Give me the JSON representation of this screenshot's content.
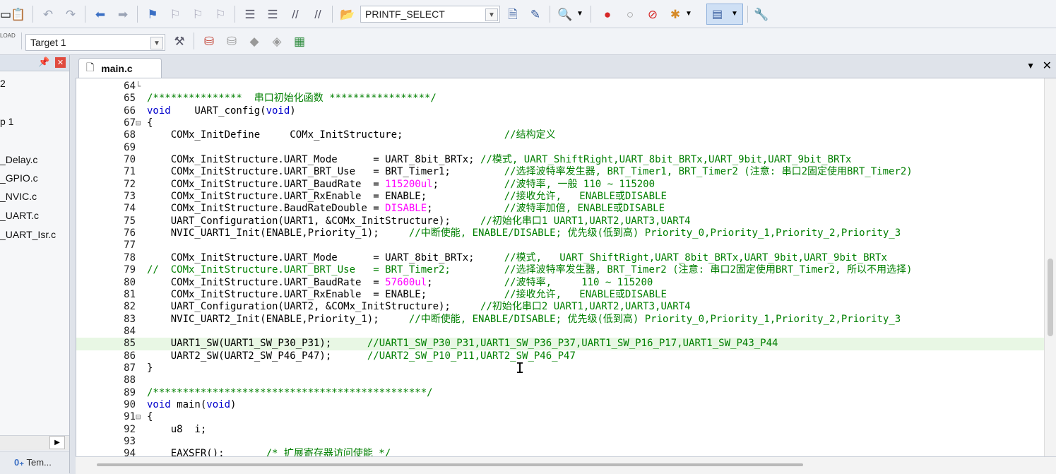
{
  "toolbar": {
    "target_combo_value": "PRINTF_SELECT",
    "target_label": "Target 1",
    "load_label": "LOAD"
  },
  "project": {
    "items": [
      "2",
      "p 1",
      "_Delay.c",
      "_GPIO.c",
      "_NVIC.c",
      "_UART.c",
      "_UART_Isr.c"
    ],
    "bottom_tab": "Tem..."
  },
  "editor": {
    "tab_name": "main.c",
    "lines": [
      {
        "n": "64",
        "fold": "└",
        "code": ""
      },
      {
        "n": "65",
        "fold": "",
        "code": "/***************  串口初始化函数 *****************/"
      },
      {
        "n": "66",
        "fold": "",
        "code": "void    UART_config(void)"
      },
      {
        "n": "67",
        "fold": "⊟",
        "code": "{"
      },
      {
        "n": "68",
        "fold": "",
        "code": "    COMx_InitDefine     COMx_InitStructure;                 //结构定义"
      },
      {
        "n": "69",
        "fold": "",
        "code": ""
      },
      {
        "n": "70",
        "fold": "",
        "code": "    COMx_InitStructure.UART_Mode      = UART_8bit_BRTx; //模式, UART_ShiftRight,UART_8bit_BRTx,UART_9bit,UART_9bit_BRTx"
      },
      {
        "n": "71",
        "fold": "",
        "code": "    COMx_InitStructure.UART_BRT_Use   = BRT_Timer1;         //选择波特率发生器, BRT_Timer1, BRT_Timer2 (注意: 串口2固定使用BRT_Timer2)"
      },
      {
        "n": "72",
        "fold": "",
        "code": "    COMx_InitStructure.UART_BaudRate  = 115200ul;           //波特率, 一般 110 ~ 115200"
      },
      {
        "n": "73",
        "fold": "",
        "code": "    COMx_InitStructure.UART_RxEnable  = ENABLE;             //接收允许,   ENABLE或DISABLE"
      },
      {
        "n": "74",
        "fold": "",
        "code": "    COMx_InitStructure.BaudRateDouble = DISABLE;            //波特率加倍, ENABLE或DISABLE"
      },
      {
        "n": "75",
        "fold": "",
        "code": "    UART_Configuration(UART1, &COMx_InitStructure);     //初始化串口1 UART1,UART2,UART3,UART4"
      },
      {
        "n": "76",
        "fold": "",
        "code": "    NVIC_UART1_Init(ENABLE,Priority_1);     //中断使能, ENABLE/DISABLE; 优先级(低到高) Priority_0,Priority_1,Priority_2,Priority_3"
      },
      {
        "n": "77",
        "fold": "",
        "code": ""
      },
      {
        "n": "78",
        "fold": "",
        "code": "    COMx_InitStructure.UART_Mode      = UART_8bit_BRTx;     //模式,   UART_ShiftRight,UART_8bit_BRTx,UART_9bit,UART_9bit_BRTx"
      },
      {
        "n": "79",
        "fold": "",
        "code": "//  COMx_InitStructure.UART_BRT_Use   = BRT_Timer2;         //选择波特率发生器, BRT_Timer2 (注意: 串口2固定使用BRT_Timer2, 所以不用选择)"
      },
      {
        "n": "80",
        "fold": "",
        "code": "    COMx_InitStructure.UART_BaudRate  = 57600ul;            //波特率,     110 ~ 115200"
      },
      {
        "n": "81",
        "fold": "",
        "code": "    COMx_InitStructure.UART_RxEnable  = ENABLE;             //接收允许,   ENABLE或DISABLE"
      },
      {
        "n": "82",
        "fold": "",
        "code": "    UART_Configuration(UART2, &COMx_InitStructure);     //初始化串口2 UART1,UART2,UART3,UART4"
      },
      {
        "n": "83",
        "fold": "",
        "code": "    NVIC_UART2_Init(ENABLE,Priority_1);     //中断使能, ENABLE/DISABLE; 优先级(低到高) Priority_0,Priority_1,Priority_2,Priority_3"
      },
      {
        "n": "84",
        "fold": "",
        "code": ""
      },
      {
        "n": "85",
        "fold": "",
        "code": "    UART1_SW(UART1_SW_P30_P31);      //UART1_SW_P30_P31,UART1_SW_P36_P37,UART1_SW_P16_P17,UART1_SW_P43_P44"
      },
      {
        "n": "86",
        "fold": "",
        "code": "    UART2_SW(UART2_SW_P46_P47);      //UART2_SW_P10_P11,UART2_SW_P46_P47"
      },
      {
        "n": "87",
        "fold": "",
        "code": "}"
      },
      {
        "n": "88",
        "fold": "",
        "code": ""
      },
      {
        "n": "89",
        "fold": "",
        "code": "/**********************************************/"
      },
      {
        "n": "90",
        "fold": "",
        "code": "void main(void)"
      },
      {
        "n": "91",
        "fold": "⊟",
        "code": "{"
      },
      {
        "n": "92",
        "fold": "",
        "code": "    u8  i;"
      },
      {
        "n": "93",
        "fold": "",
        "code": ""
      },
      {
        "n": "94",
        "fold": "",
        "code": "    EAXSFR();       /* 扩展寄存器访问使能 */"
      }
    ]
  },
  "colors": {
    "keyword": "#0000cc",
    "comment": "#007f00",
    "number": "#ff00ff",
    "highlight_line": "#e8f7e4"
  }
}
